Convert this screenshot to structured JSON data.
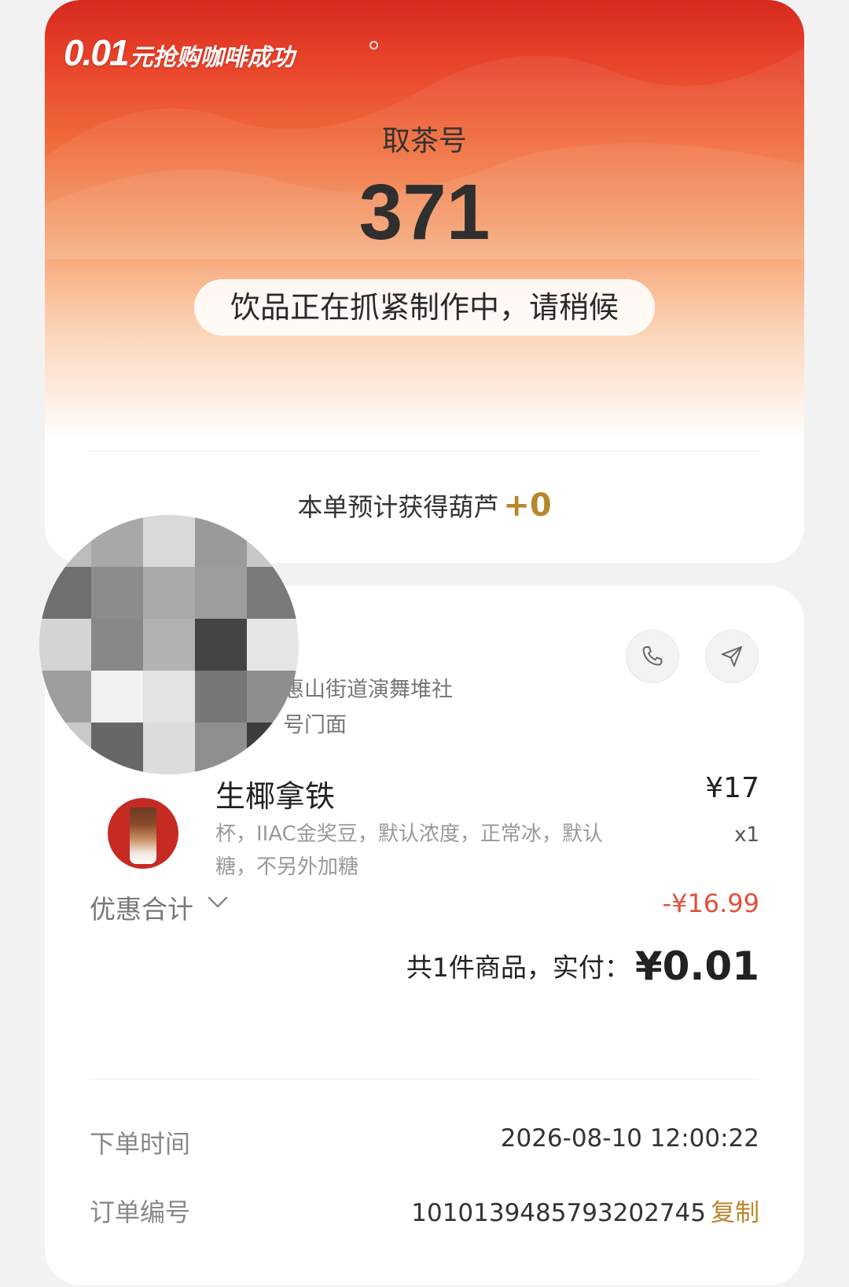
{
  "promo": {
    "amount": "0.01",
    "text": "元抢购咖啡成功"
  },
  "pickup": {
    "label": "取茶号",
    "number": "371",
    "status": "饮品正在抓紧制作中，请稍候"
  },
  "points": {
    "text": "本单预计获得葫芦",
    "value": "+0"
  },
  "store": {
    "address_line1": "惠山街道演舞堆社",
    "address_line2": "号门面",
    "call_icon": "phone-icon",
    "nav_icon": "navigate-icon"
  },
  "item": {
    "name": "生椰拿铁",
    "price": "¥17",
    "quantity": "x1",
    "options": "杯，IIAC金奖豆，默认浓度，正常冰，默认糖，不另外加糖"
  },
  "discount": {
    "label": "优惠合计",
    "value": "-¥16.99"
  },
  "total": {
    "prefix": "共1件商品，实付：",
    "amount": "¥0.01"
  },
  "info": {
    "order_time_label": "下单时间",
    "order_time": "2026-08-10 12:00:22",
    "order_no_label": "订单编号",
    "order_no": "1010139485793202745",
    "copy": "复制"
  },
  "colors": {
    "hero_red": "#d62a1f",
    "gold": "#b8872c",
    "discount_red": "#e0503c"
  }
}
